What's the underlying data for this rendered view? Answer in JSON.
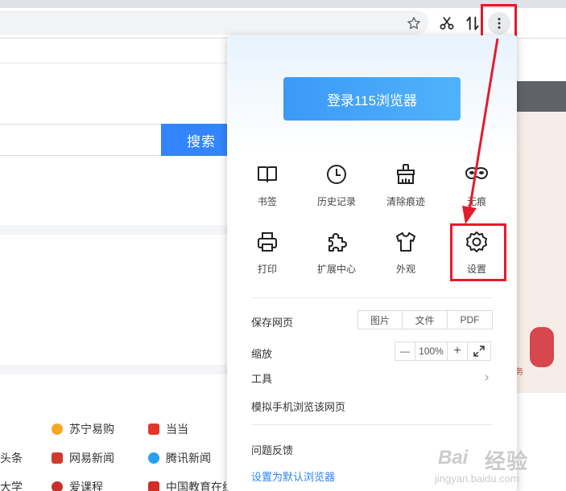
{
  "search": {
    "button_label": "搜索"
  },
  "menu": {
    "login_label": "登录115浏览器",
    "grid": [
      {
        "label": "书签",
        "icon": "book-icon"
      },
      {
        "label": "历史记录",
        "icon": "clock-icon"
      },
      {
        "label": "清除痕迹",
        "icon": "broom-icon"
      },
      {
        "label": "无痕",
        "icon": "incognito-mask-icon"
      },
      {
        "label": "打印",
        "icon": "printer-icon"
      },
      {
        "label": "扩展中心",
        "icon": "puzzle-icon"
      },
      {
        "label": "外观",
        "icon": "shirt-icon"
      },
      {
        "label": "设置",
        "icon": "gear-icon"
      }
    ],
    "save_page": {
      "label": "保存网页",
      "options": [
        "图片",
        "文件",
        "PDF"
      ]
    },
    "zoom": {
      "label": "缩放",
      "minus": "—",
      "value": "100%",
      "plus": "+"
    },
    "tools_label": "工具",
    "mobile_label": "模拟手机浏览该网页",
    "feedback_label": "问题反馈",
    "default_label": "设置为默认浏览器"
  },
  "links": [
    {
      "text": "苏宁易购",
      "color": "#f5a623"
    },
    {
      "text": "当当",
      "color": "#e2362a"
    },
    {
      "text": "头条",
      "color": "#e2362a"
    },
    {
      "text": "网易新闻",
      "color": "#d23a2e"
    },
    {
      "text": "腾讯新闻",
      "color": "#2a9ff0"
    },
    {
      "text": "大学",
      "color": "#e2362a"
    },
    {
      "text": "爱课程",
      "color": "#c9302c"
    },
    {
      "text": "中国教育在线",
      "color": "#d02f25"
    }
  ],
  "banner": {
    "badge_text": "",
    "tag_text": "务"
  },
  "watermark": {
    "logo": "Bai",
    "brand": "经验",
    "sub": "jingyan.baidu.com"
  },
  "colors": {
    "accent": "#3385ff",
    "highlight": "#e41b2b",
    "login": "#3c99f7"
  }
}
